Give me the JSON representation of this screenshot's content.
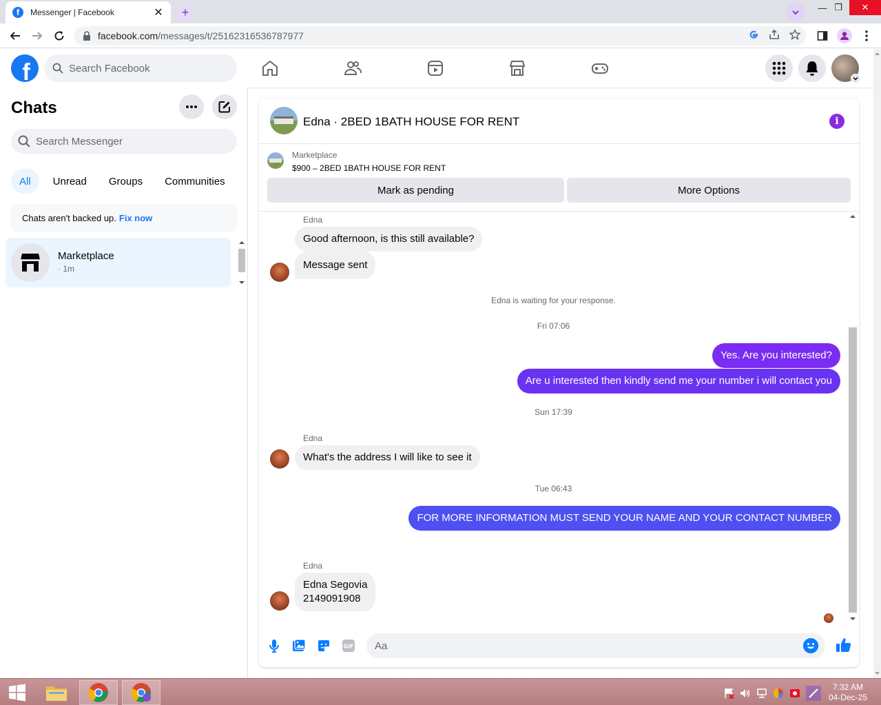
{
  "browser": {
    "tab_title": "Messenger | Facebook",
    "url_host": "facebook.com",
    "url_path": "/messages/t/25162316536787977"
  },
  "fb": {
    "search_placeholder": "Search Facebook"
  },
  "chats": {
    "title": "Chats",
    "search_placeholder": "Search Messenger",
    "filters": [
      "All",
      "Unread",
      "Groups",
      "Communities"
    ],
    "backup_text": "Chats aren't backed up.",
    "backup_link": "Fix now",
    "items": [
      {
        "name": "Marketplace",
        "time": "· 1m"
      }
    ]
  },
  "conversation": {
    "title": "Edna · 2BED 1BATH HOUSE FOR RENT",
    "listing_label": "Marketplace",
    "listing_price": "$900 – 2BED 1BATH HOUSE FOR RENT",
    "btn_pending": "Mark as pending",
    "btn_more": "More Options",
    "sender_name": "Edna",
    "messages": {
      "m1": "Good afternoon, is this still available?",
      "m2": "Message sent",
      "waiting": "Edna is waiting for your response.",
      "ts1": "Fri 07:06",
      "m3": "Yes. Are you interested?",
      "m4": "Are u interested then kindly send me your number i will contact you",
      "ts2": "Sun 17:39",
      "m5": "What's the address I will like to see it",
      "ts3": "Tue 06:43",
      "m6": "FOR MORE INFORMATION MUST SEND YOUR NAME AND YOUR CONTACT NUMBER",
      "m7_line1": "Edna Segovia",
      "m7_line2": "2149091908"
    },
    "composer_placeholder": "Aa"
  },
  "taskbar": {
    "time": "7:32 AM",
    "date": "04-Dec-25"
  },
  "colors": {
    "fb_blue": "#1877f2",
    "msg_purple": "#7a2cf2",
    "msg_indigo": "#4f4ff2",
    "info_purple": "#8a2be2"
  }
}
